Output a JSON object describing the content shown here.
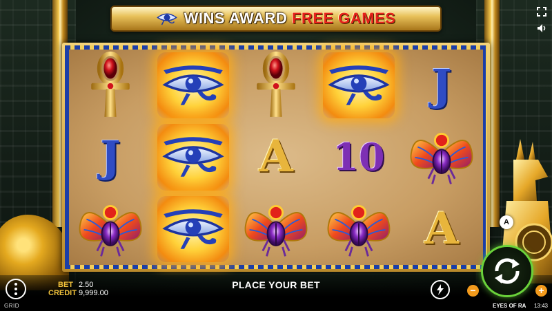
{
  "banner": {
    "part1": "WINS AWARD ",
    "part2": "FREE GAMES",
    "icon": "eye-of-ra-icon"
  },
  "reels": [
    [
      "ankh",
      "eye",
      "ankh",
      "eye",
      "J"
    ],
    [
      "J",
      "eye",
      "A",
      "10",
      "scarab"
    ],
    [
      "scarab",
      "eye",
      "scarab",
      "scarab",
      "A"
    ]
  ],
  "winning_cells": [
    [
      0,
      1
    ],
    [
      0,
      3
    ],
    [
      1,
      1
    ],
    [
      2,
      1
    ]
  ],
  "bet": {
    "label": "BET",
    "value": "2.50"
  },
  "credit": {
    "label": "CREDIT",
    "value": "9,999.00"
  },
  "status_message": "PLACE YOUR BET",
  "controls": {
    "minus": "−",
    "plus": "+",
    "autoplay": "A"
  },
  "footer": {
    "provider": "GRID",
    "game_name": "EYES OF RA",
    "time": "13:43"
  },
  "colors": {
    "accent_gold": "#f1c23b",
    "spin_ring": "#6ad23a",
    "bet_buttons": "#f29a1c"
  }
}
